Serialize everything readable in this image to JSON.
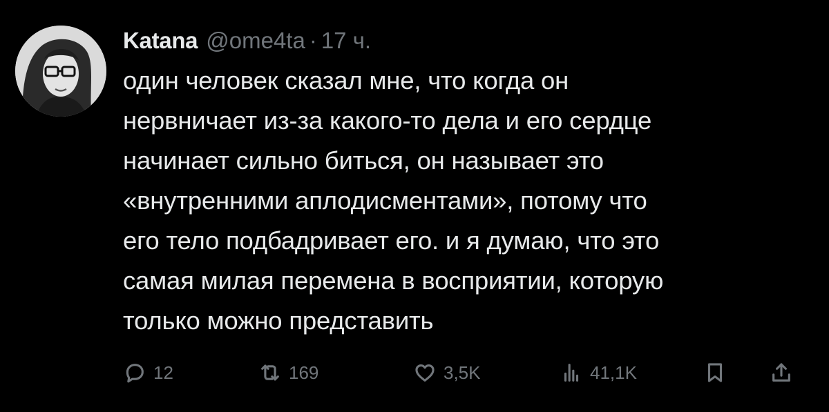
{
  "author": {
    "name": "Katana",
    "handle": "@ome4ta",
    "separator": "·",
    "time": "17 ч."
  },
  "tweet": {
    "lines": [
      "один человек сказал мне, что когда он",
      "нервничает из-за какого-то дела и его сердце",
      "начинает сильно биться, он называет это",
      "«внутренними аплодисментами», потому что",
      "его тело подбадривает его. и я думаю, что это",
      "самая милая перемена в восприятии, которую",
      "только можно представить"
    ]
  },
  "stats": {
    "replies": "12",
    "retweets": "169",
    "likes": "3,5K",
    "views": "41,1K"
  },
  "icons": {
    "reply": "speech-bubble-icon",
    "retweet": "retweet-arrows-icon",
    "like": "heart-icon",
    "views": "bar-chart-icon",
    "bookmark": "bookmark-icon",
    "share": "share-upload-icon",
    "more": "more-dots-icon"
  },
  "colors": {
    "background": "#000000",
    "text": "#e7e9ea",
    "muted": "#71767b"
  }
}
